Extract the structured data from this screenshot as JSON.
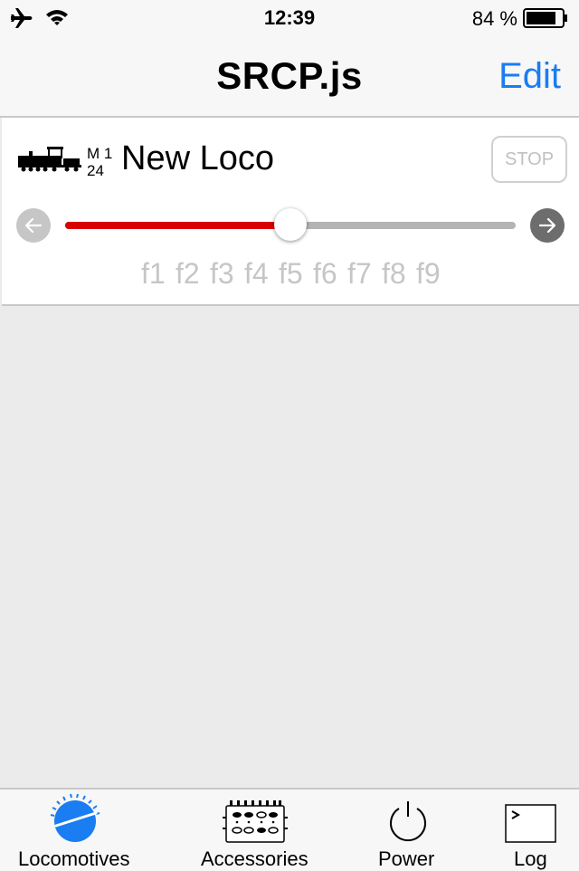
{
  "status_bar": {
    "time": "12:39",
    "battery_percent": "84 %",
    "battery_level": 0.84,
    "icons": [
      "airplane-icon",
      "wifi-icon",
      "battery-icon"
    ]
  },
  "nav": {
    "title": "SRCP.js",
    "edit_label": "Edit"
  },
  "loco": {
    "protocol": "M 1",
    "address": "24",
    "name": "New Loco",
    "stop_label": "STOP",
    "speed_fraction": 0.5,
    "functions": [
      "f1",
      "f2",
      "f3",
      "f4",
      "f5",
      "f6",
      "f7",
      "f8",
      "f9"
    ]
  },
  "tabs": [
    {
      "label": "Locomotives",
      "icon": "speedometer-icon",
      "active": true
    },
    {
      "label": "Accessories",
      "icon": "switchboard-icon",
      "active": false
    },
    {
      "label": "Power",
      "icon": "power-icon",
      "active": false
    },
    {
      "label": "Log",
      "icon": "terminal-icon",
      "active": false
    }
  ],
  "colors": {
    "accent": "#1a7df2",
    "speed_fill": "#d90000",
    "track": "#b4b4b4",
    "background": "#ebebeb"
  }
}
